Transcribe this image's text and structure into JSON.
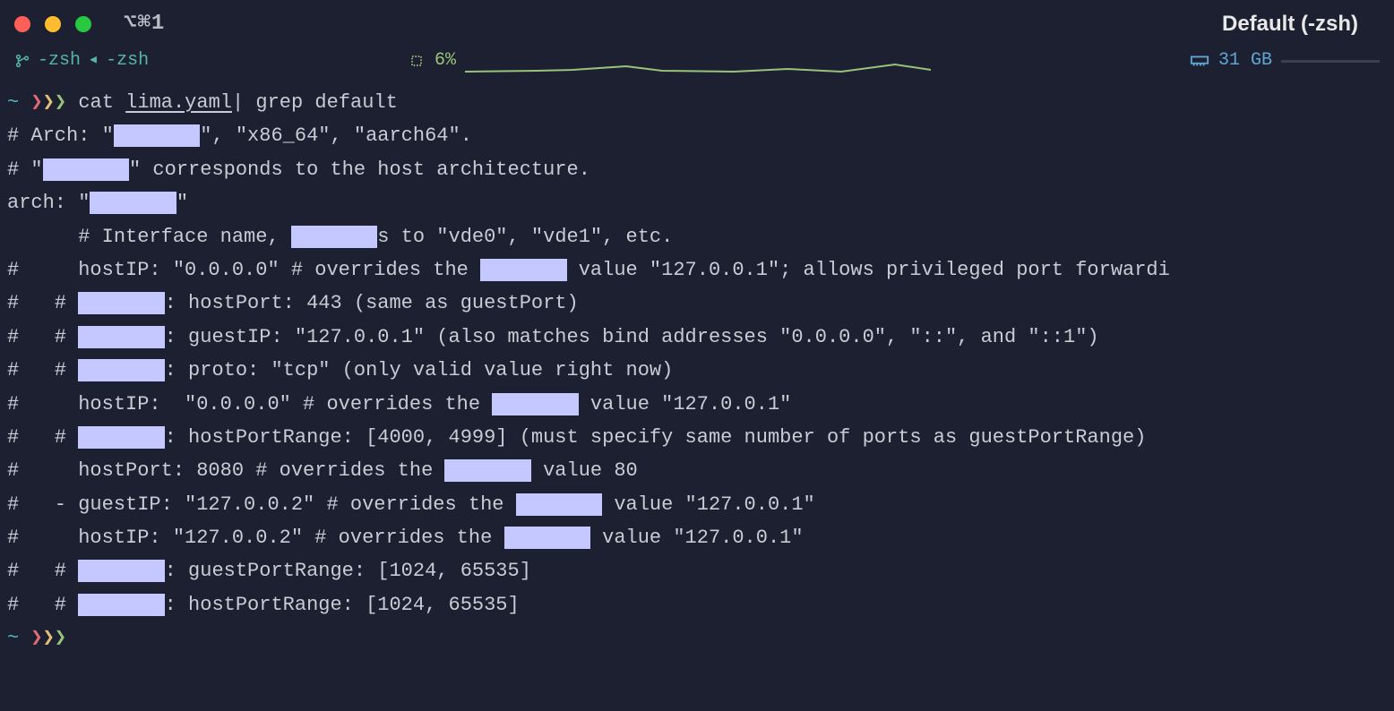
{
  "titlebar": {
    "tab": "⌥⌘1",
    "title": "Default (-zsh)"
  },
  "statusbar": {
    "shell_left": "-zsh",
    "shell_sep": "◂",
    "shell_right": "-zsh",
    "cpu_pct": "6%",
    "ram": "31 GB"
  },
  "prompt": {
    "tilde": "~",
    "ps1": "❯❯❯"
  },
  "command": {
    "pre": "cat ",
    "file": "lima.yaml",
    "post": "| grep default"
  },
  "match": "default",
  "lines": [
    {
      "segs": [
        {
          "t": "# Arch: \""
        },
        {
          "m": true
        },
        {
          "t": "\", \"x86_64\", \"aarch64\"."
        }
      ]
    },
    {
      "segs": [
        {
          "t": "# \""
        },
        {
          "m": true
        },
        {
          "t": "\" corresponds to the host architecture."
        }
      ]
    },
    {
      "segs": [
        {
          "t": "arch: \""
        },
        {
          "m": true
        },
        {
          "t": "\""
        }
      ]
    },
    {
      "segs": [
        {
          "t": "      # Interface name, "
        },
        {
          "m": true
        },
        {
          "t": "s to \"vde0\", \"vde1\", etc."
        }
      ]
    },
    {
      "segs": [
        {
          "t": "#     hostIP: \"0.0.0.0\" # overrides the "
        },
        {
          "m": true
        },
        {
          "t": " value \"127.0.0.1\"; allows privileged port forwardi"
        }
      ]
    },
    {
      "segs": [
        {
          "t": "#   # "
        },
        {
          "m": true
        },
        {
          "t": ": hostPort: 443 (same as guestPort)"
        }
      ]
    },
    {
      "segs": [
        {
          "t": "#   # "
        },
        {
          "m": true
        },
        {
          "t": ": guestIP: \"127.0.0.1\" (also matches bind addresses \"0.0.0.0\", \"::\", and \"::1\")"
        }
      ]
    },
    {
      "segs": [
        {
          "t": "#   # "
        },
        {
          "m": true
        },
        {
          "t": ": proto: \"tcp\" (only valid value right now)"
        }
      ]
    },
    {
      "segs": [
        {
          "t": "#     hostIP:  \"0.0.0.0\" # overrides the "
        },
        {
          "m": true
        },
        {
          "t": " value \"127.0.0.1\""
        }
      ]
    },
    {
      "segs": [
        {
          "t": "#   # "
        },
        {
          "m": true
        },
        {
          "t": ": hostPortRange: [4000, 4999] (must specify same number of ports as guestPortRange)"
        }
      ]
    },
    {
      "segs": [
        {
          "t": "#     hostPort: 8080 # overrides the "
        },
        {
          "m": true
        },
        {
          "t": " value 80"
        }
      ]
    },
    {
      "segs": [
        {
          "t": "#   - guestIP: \"127.0.0.2\" # overrides the "
        },
        {
          "m": true
        },
        {
          "t": " value \"127.0.0.1\""
        }
      ]
    },
    {
      "segs": [
        {
          "t": "#     hostIP: \"127.0.0.2\" # overrides the "
        },
        {
          "m": true
        },
        {
          "t": " value \"127.0.0.1\""
        }
      ]
    },
    {
      "segs": [
        {
          "t": "#   # "
        },
        {
          "m": true
        },
        {
          "t": ": guestPortRange: [1024, 65535]"
        }
      ]
    },
    {
      "segs": [
        {
          "t": "#   # "
        },
        {
          "m": true
        },
        {
          "t": ": hostPortRange: [1024, 65535]"
        }
      ]
    }
  ]
}
